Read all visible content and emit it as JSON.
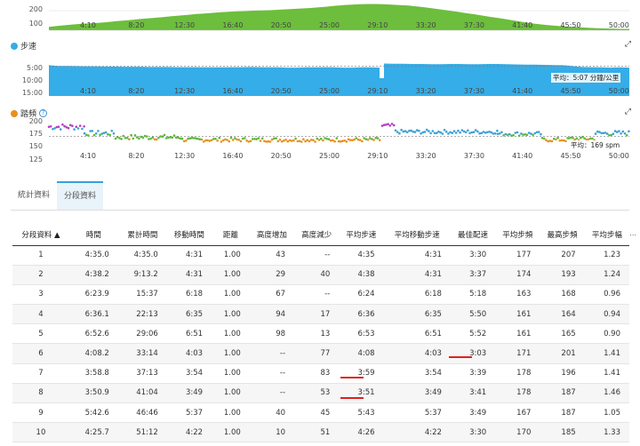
{
  "charts": {
    "x_ticks": [
      "4:10",
      "8:20",
      "12:30",
      "16:40",
      "20:50",
      "25:00",
      "29:10",
      "33:20",
      "37:30",
      "41:40",
      "45:50",
      "50:00"
    ],
    "elevation": {
      "y_ticks": [
        "200",
        "100"
      ],
      "color": "#6cbe3c",
      "profile": [
        30,
        38,
        45,
        52,
        58,
        62,
        66,
        72,
        80,
        86,
        92,
        100,
        106,
        112,
        118,
        126,
        132,
        138,
        146,
        150,
        156,
        162,
        166,
        170,
        172,
        176,
        178,
        180,
        184,
        188,
        192,
        196,
        200,
        206,
        212,
        220,
        226,
        230,
        234,
        236,
        236,
        234,
        230,
        226,
        222,
        214,
        206,
        196,
        186,
        176,
        166,
        154,
        144,
        132,
        120,
        110,
        98,
        86,
        74,
        62,
        54,
        46,
        40,
        34,
        30,
        26,
        22,
        18,
        16,
        14,
        12,
        12
      ]
    },
    "pace": {
      "title": "步速",
      "color": "#35ade8",
      "y_ticks": [
        "5:00",
        "10:00",
        "15:00"
      ],
      "avg_label": "平均：5:07 分鐘/公里",
      "avg_value": 5.12,
      "profile_first": [
        4.6,
        4.9,
        4.9,
        5.0,
        5.1,
        5.1,
        5.2,
        5.2,
        5.3,
        5.3,
        5.3,
        5.4,
        5.4,
        5.4,
        5.5,
        5.5,
        5.5,
        5.6,
        5.6,
        5.6,
        5.5,
        5.5,
        5.4,
        5.5,
        5.6,
        5.6,
        5.7,
        5.7,
        5.6,
        5.6,
        5.5,
        5.6,
        5.7,
        5.7,
        5.6,
        5.6,
        5.7
      ],
      "profile_second": [
        3.8,
        3.9,
        3.9,
        4.0,
        4.0,
        4.1,
        4.1,
        4.0,
        4.0,
        4.1,
        4.1,
        4.0,
        4.0,
        4.1,
        4.2,
        4.3,
        4.3,
        4.4,
        4.5,
        4.6,
        5.0,
        5.4,
        5.5,
        5.6,
        5.7,
        5.6,
        5.7
      ]
    },
    "cadence": {
      "title": "踏頻",
      "help": "?",
      "y_ticks": [
        "200",
        "175",
        "150",
        "125"
      ],
      "avg_label": "平均：169 spm",
      "avg_value": 169,
      "colors": {
        "high": "#b040c0",
        "mid": "#3aa0d8",
        "normal": "#5cb83c",
        "low": "#e8901c"
      }
    }
  },
  "tabs": {
    "stats": "統計資料",
    "splits": "分段資料"
  },
  "table": {
    "columns": [
      "分段資料 ▲",
      "時間",
      "累計時間",
      "移動時間",
      "距離",
      "高度增加",
      "高度減少",
      "平均步速",
      "平均移動步速",
      "最佳配速",
      "平均步頻",
      "最高步頻",
      "平均步幅"
    ],
    "rows": [
      [
        "1",
        "4:35.0",
        "4:35.0",
        "4:31",
        "1.00",
        "43",
        "--",
        "4:35",
        "4:31",
        "3:30",
        "177",
        "207",
        "1.23"
      ],
      [
        "2",
        "4:38.2",
        "9:13.2",
        "4:31",
        "1.00",
        "29",
        "40",
        "4:38",
        "4:31",
        "3:37",
        "174",
        "193",
        "1.24"
      ],
      [
        "3",
        "6:23.9",
        "15:37",
        "6:18",
        "1.00",
        "67",
        "--",
        "6:24",
        "6:18",
        "5:18",
        "163",
        "168",
        "0.96"
      ],
      [
        "4",
        "6:36.1",
        "22:13",
        "6:35",
        "1.00",
        "94",
        "17",
        "6:36",
        "6:35",
        "5:50",
        "161",
        "164",
        "0.94"
      ],
      [
        "5",
        "6:52.6",
        "29:06",
        "6:51",
        "1.00",
        "98",
        "13",
        "6:53",
        "6:51",
        "5:52",
        "161",
        "165",
        "0.90"
      ],
      [
        "6",
        "4:08.2",
        "33:14",
        "4:03",
        "1.00",
        "--",
        "77",
        "4:08",
        "4:03",
        "3:03",
        "171",
        "201",
        "1.41"
      ],
      [
        "7",
        "3:58.8",
        "37:13",
        "3:54",
        "1.00",
        "--",
        "83",
        "3:59",
        "3:54",
        "3:39",
        "178",
        "196",
        "1.41"
      ],
      [
        "8",
        "3:50.9",
        "41:04",
        "3:49",
        "1.00",
        "--",
        "53",
        "3:51",
        "3:49",
        "3:41",
        "178",
        "187",
        "1.46"
      ],
      [
        "9",
        "5:42.6",
        "46:46",
        "5:37",
        "1.00",
        "40",
        "45",
        "5:43",
        "5:37",
        "3:49",
        "167",
        "187",
        "1.05"
      ],
      [
        "10",
        "4:25.7",
        "51:12",
        "4:22",
        "1.00",
        "10",
        "51",
        "4:26",
        "4:22",
        "3:30",
        "170",
        "185",
        "1.33"
      ]
    ],
    "more": "..."
  },
  "highlight_color": "#e02020"
}
